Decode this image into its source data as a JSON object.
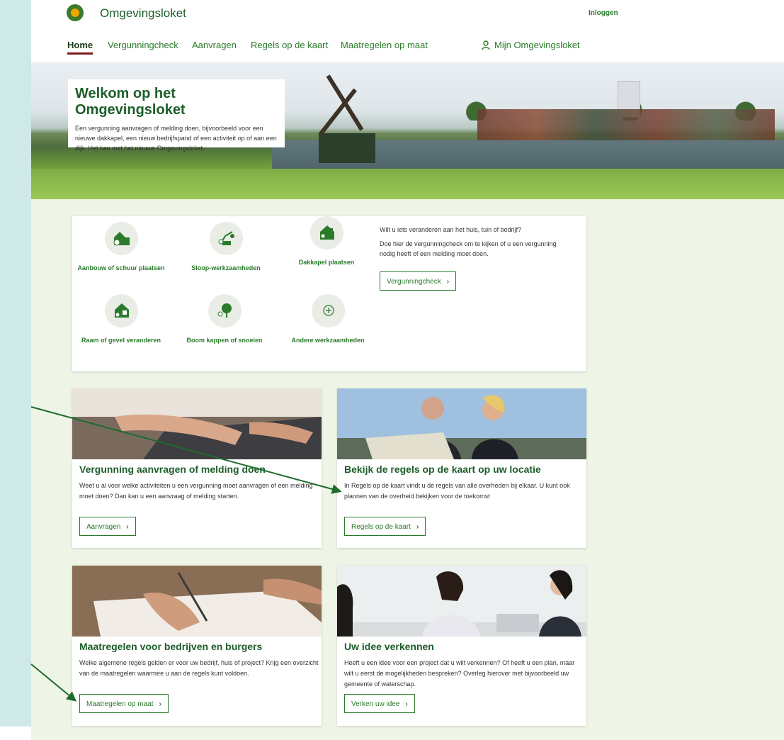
{
  "header": {
    "brand": "Omgevingsloket",
    "login": "Inloggen",
    "nav": {
      "home": "Home",
      "vergunningcheck": "Vergunningcheck",
      "aanvragen": "Aanvragen",
      "regels": "Regels op de kaart",
      "maatregelen": "Maatregelen op maat",
      "mijn": "Mijn Omgevingsloket"
    }
  },
  "hero": {
    "title": "Welkom op het Omgevingsloket",
    "text": "Een vergunning aanvragen of melding doen, bijvoorbeeld voor een nieuwe dakkapel, een nieuw bedrijfspand of een activiteit op of aan een dijk. Het kan met het nieuwe Omgevingsloket."
  },
  "activities": {
    "items": [
      {
        "label": "Aanbouw of schuur plaatsen",
        "icon": "house-extension-icon"
      },
      {
        "label": "Sloop-werkzaamheden",
        "icon": "demolition-crane-icon"
      },
      {
        "label": "Dakkapel plaatsen",
        "icon": "dormer-house-icon"
      },
      {
        "label": "Raam of gevel veranderen",
        "icon": "window-facade-icon"
      },
      {
        "label": "Boom kappen of snoeien",
        "icon": "tree-icon"
      },
      {
        "label": "Andere werkzaamheden",
        "icon": "plus-circle-icon"
      }
    ],
    "intro": "Wilt u iets veranderen aan het huis, tuin of bedrijf?",
    "text": "Doe hier de vergunningcheck om te kijken of u een vergunning nodig heeft of een melding moet doen.",
    "button": "Vergunningcheck"
  },
  "cards": [
    {
      "title": "Vergunning aanvragen of melding doen",
      "text": "Weet u al voor welke activiteiten u een vergunning moet aanvragen of een melding moet doen? Dan kan u een aanvraag of melding starten.",
      "button": "Aanvragen"
    },
    {
      "title": "Bekijk de regels op de kaart op uw locatie",
      "text": "In Regels op de kaart vindt u de regels van alle overheden bij elkaar. U kunt ook plannen van de overheid bekijken voor de toekomst",
      "button": "Regels op de kaart"
    },
    {
      "title": "Maatregelen voor bedrijven en burgers",
      "text": "Welke algemene regels gelden er voor uw bedrijf, huis of project? Krijg een overzicht van de maatregelen waarmee u aan de regels kunt voldoen.",
      "button": "Maatregelen op maat"
    },
    {
      "title": "Uw idee verkennen",
      "text": "Heeft u een idee voor een project dat u wilt verkennen? Of heeft u een plan, maar wilt u eerst de mogelijkheden bespreken? Overleg hierover met bijvoorbeeld uw gemeente of waterschap.",
      "button": "Verken uw idee"
    }
  ],
  "colors": {
    "brand_green": "#2a7a2a",
    "dark_green": "#1e5e2a",
    "content_bg": "#eef4e6",
    "side_panel": "#cfe8e8",
    "annotation_arrow": "#1e6b2e"
  }
}
